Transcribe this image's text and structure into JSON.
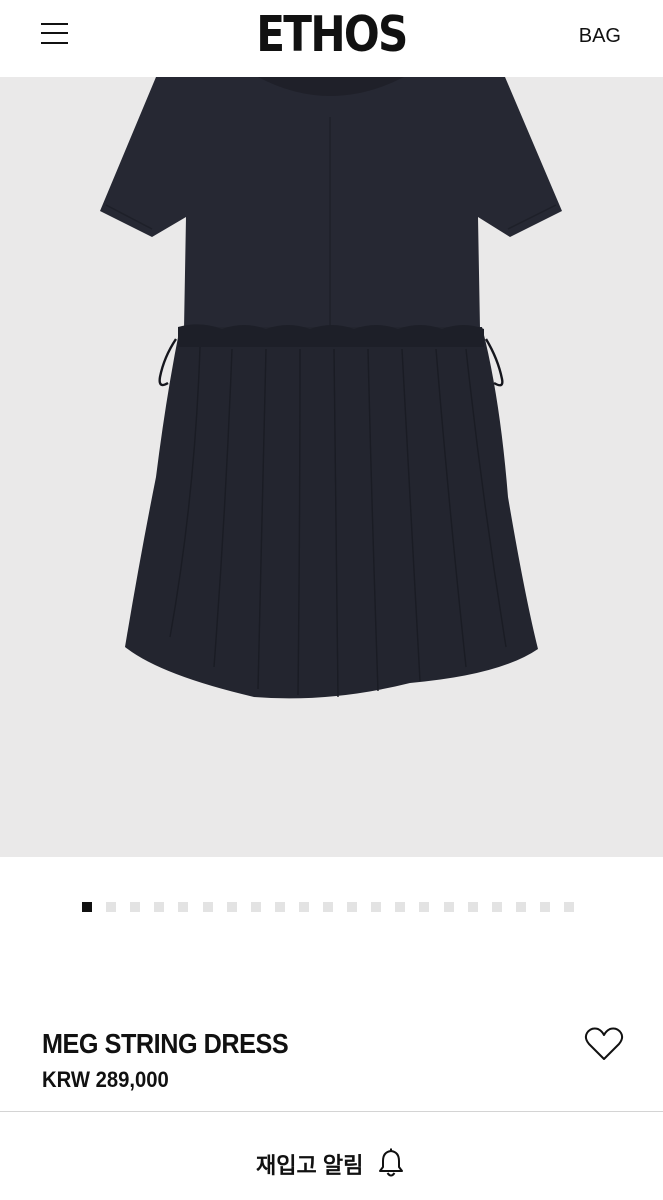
{
  "header": {
    "logo": "ETHOS",
    "bag_label": "BAG"
  },
  "gallery": {
    "image_count": 21,
    "active_index": 0
  },
  "product": {
    "name": "MEG STRING DRESS",
    "price": "KRW 289,000"
  },
  "restock": {
    "label": "재입고 알림"
  },
  "colors": {
    "dress": "#23252f",
    "image_background": "#eae9e9",
    "active_dot": "#111111",
    "inactive_dot": "#e3e3e3"
  },
  "icons": {
    "menu": "hamburger-icon",
    "wishlist": "heart-outline-icon",
    "restock": "bell-icon"
  }
}
